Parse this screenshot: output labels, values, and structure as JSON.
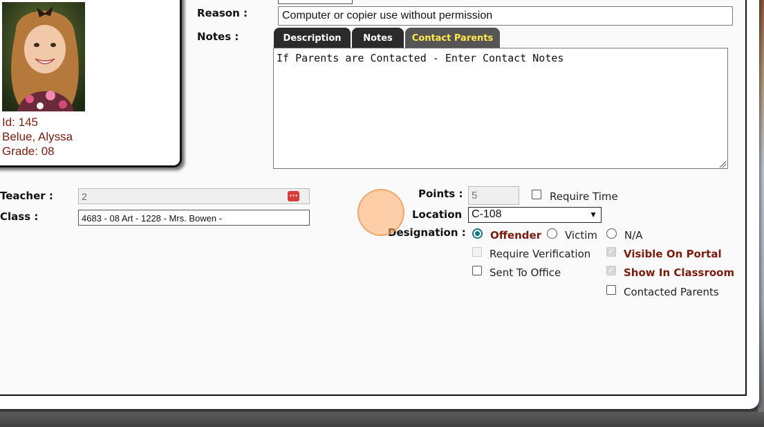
{
  "student": {
    "id_label": "Id: 145",
    "name": "Belue, Alyssa",
    "grade": "Grade: 08"
  },
  "form": {
    "reason_label": "Reason :",
    "reason_value": "Computer or copier use without permission",
    "notes_label": "Notes :",
    "tabs": [
      {
        "label": "Description",
        "active": false
      },
      {
        "label": "Notes",
        "active": false
      },
      {
        "label": "Contact Parents",
        "active": true
      }
    ],
    "notes_text": "If Parents are Contacted - Enter Contact Notes",
    "teacher_label": "Teacher :",
    "teacher_value": "2",
    "class_label": "Class :",
    "class_value": "4683 - 08 Art - 1228 - Mrs. Bowen -",
    "points_label": "Points :",
    "points_value": "5",
    "require_time_label": "Require Time",
    "location_label": "Location",
    "location_value": "C-108",
    "designation_label": "Designation :",
    "designation_options": [
      "Offender",
      "Victim",
      "N/A"
    ],
    "designation_selected": "Offender",
    "require_verification_label": "Require Verification",
    "visible_on_portal_label": "Visible On Portal",
    "sent_to_office_label": "Sent To Office",
    "show_in_classroom_label": "Show In Classroom",
    "contacted_parents_label": "Contacted Parents"
  },
  "colors": {
    "accent_red": "#7a1b0c",
    "active_tab_text": "#ffe94d",
    "tab_bg": "#2b2b2b",
    "radio_checked": "#0f7a85"
  }
}
